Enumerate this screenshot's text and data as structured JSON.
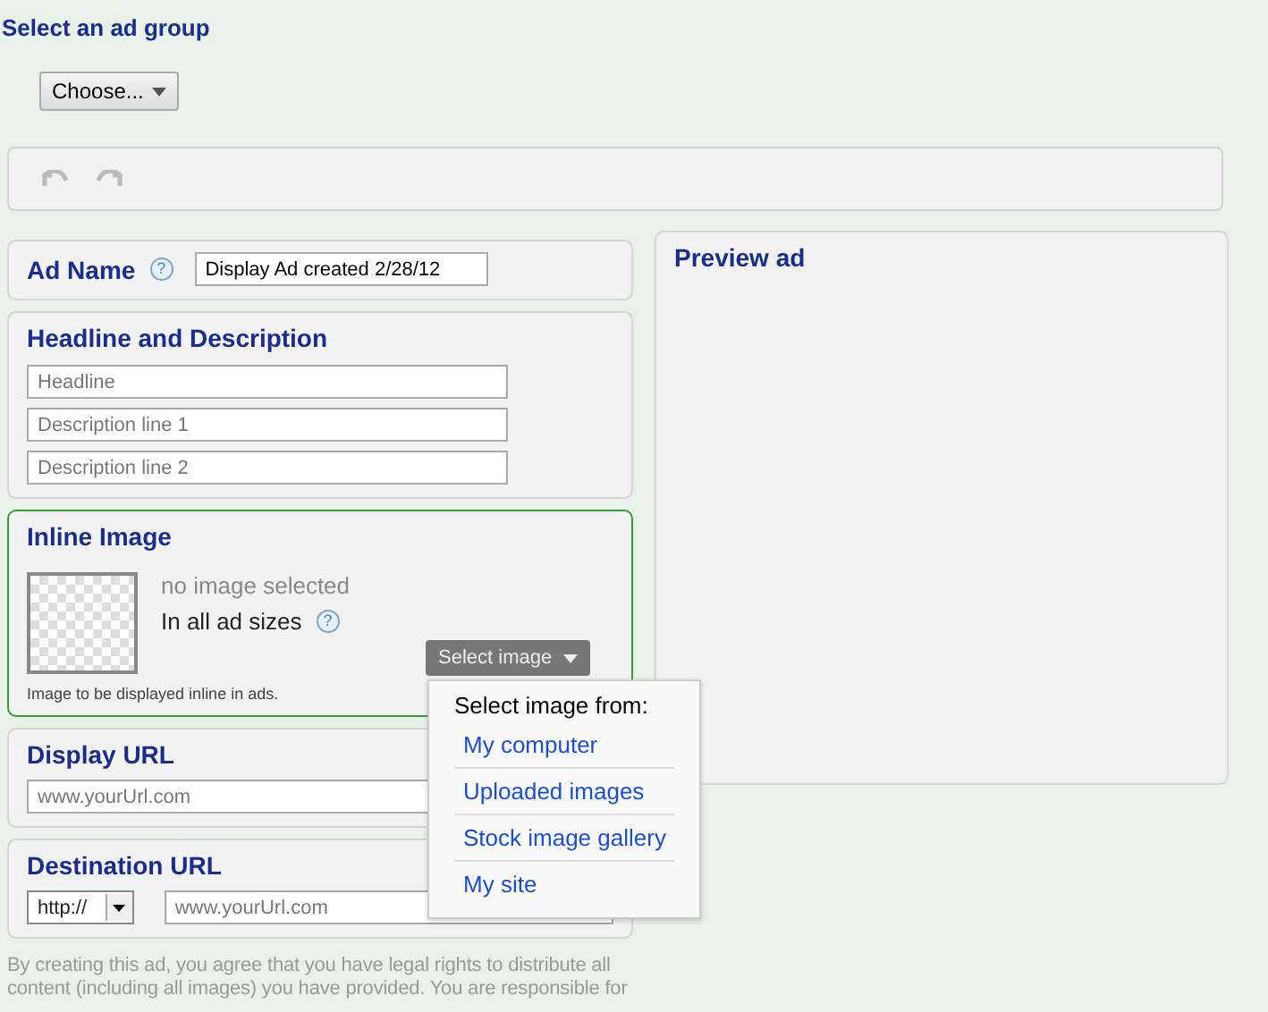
{
  "heading": "Select an ad group",
  "ad_group_button": {
    "label": "Choose..."
  },
  "toolbar": {
    "undo": {
      "disabled": true
    },
    "redo": {
      "disabled": true
    }
  },
  "ad_name": {
    "label": "Ad Name",
    "help": "?",
    "value": "Display Ad created 2/28/12"
  },
  "headline_section": {
    "title": "Headline and Description",
    "fields": [
      {
        "placeholder": "Headline"
      },
      {
        "placeholder": "Description line 1"
      },
      {
        "placeholder": "Description line 2"
      }
    ]
  },
  "inline_image": {
    "title": "Inline Image",
    "status": "no image selected",
    "sizes_label": "In all ad sizes",
    "help": "?",
    "button": "Select image",
    "note": "Image to be displayed inline in ads.",
    "menu": {
      "title": "Select image from:",
      "items": [
        "My computer",
        "Uploaded images",
        "Stock image gallery",
        "My site"
      ]
    }
  },
  "display_url": {
    "title": "Display URL",
    "placeholder": "www.yourUrl.com"
  },
  "destination_url": {
    "title": "Destination URL",
    "protocol": "http://",
    "placeholder": "www.yourUrl.com"
  },
  "preview": {
    "title": "Preview ad"
  },
  "disclaimer": "By creating this ad, you agree that you have legal rights to distribute all content (including all images) you have provided. You are responsible for"
}
